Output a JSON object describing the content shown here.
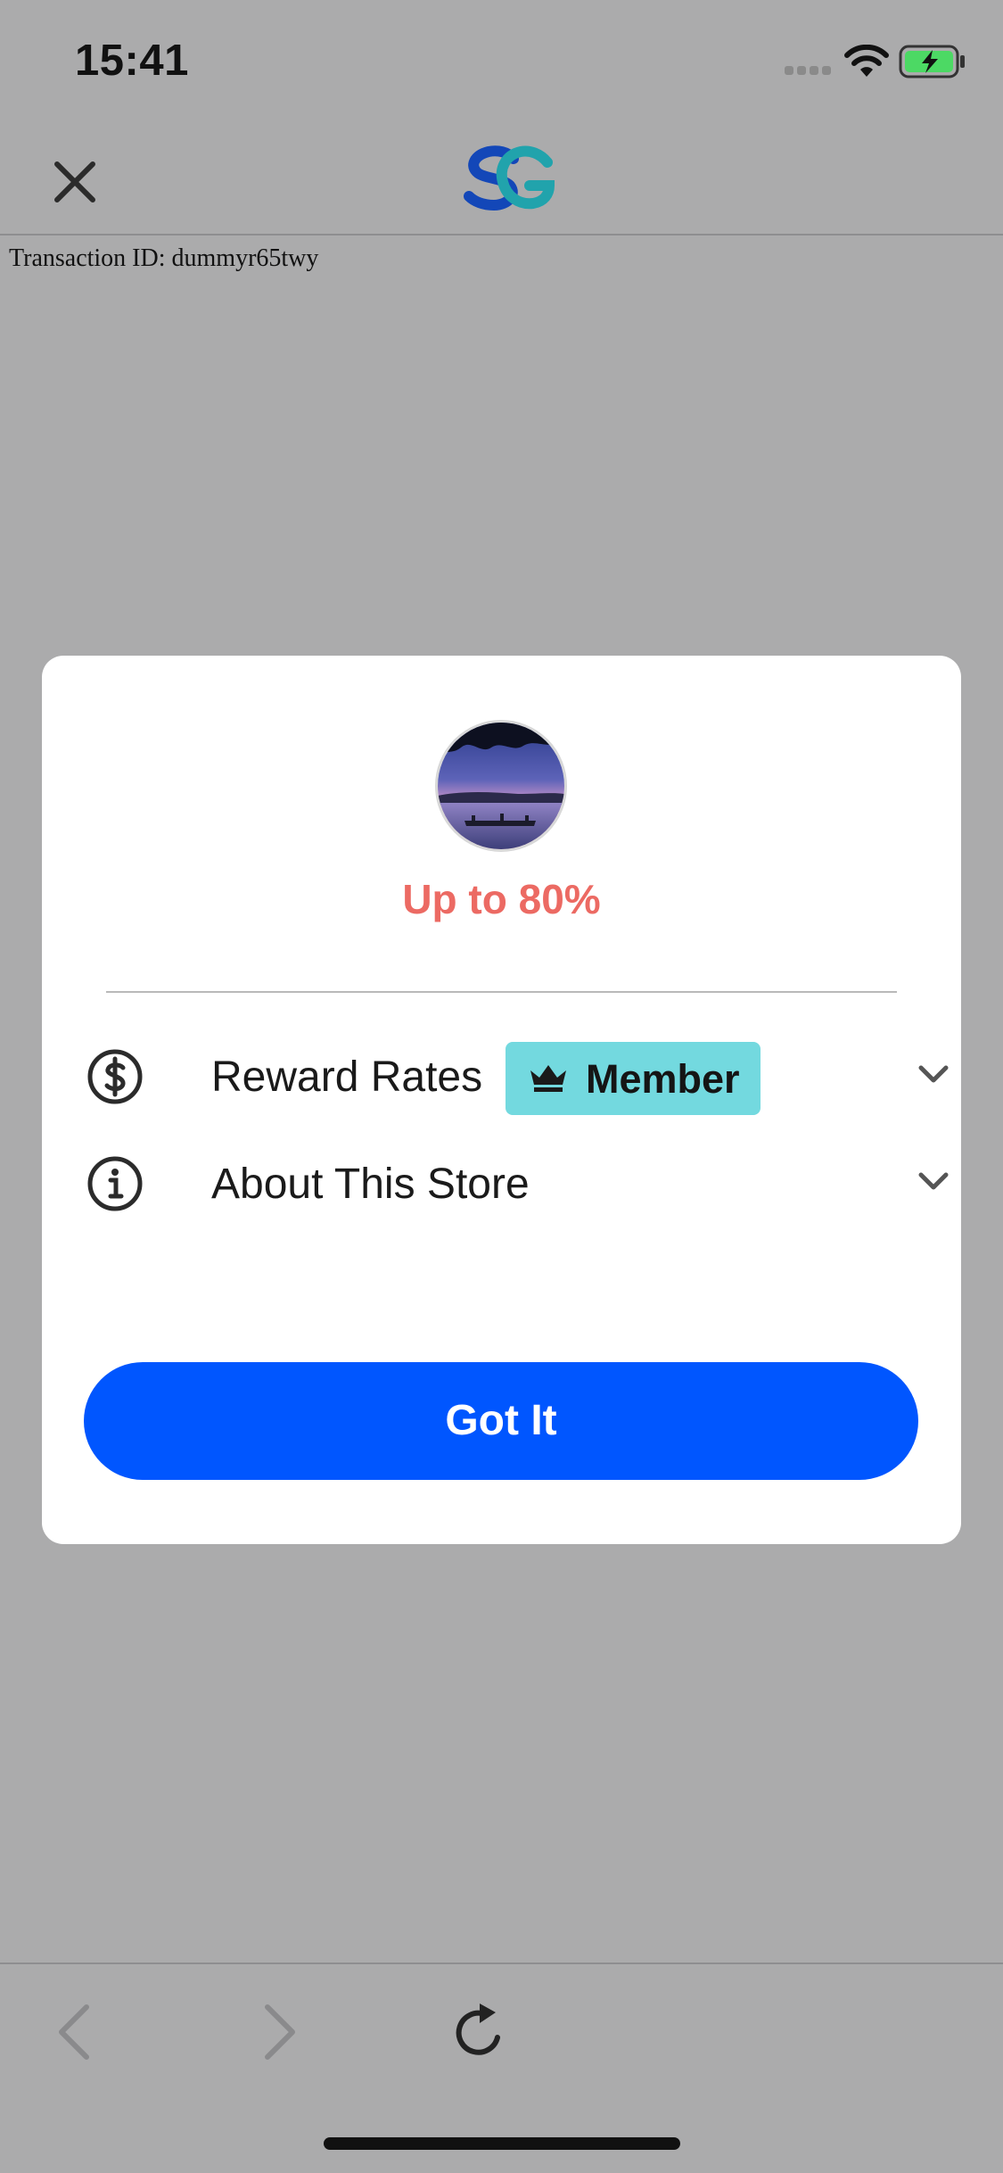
{
  "status_bar": {
    "time": "15:41"
  },
  "nav": {
    "close_icon": "close-icon",
    "logo_colors": {
      "primary": "#1347b8",
      "secondary": "#21a3ac"
    }
  },
  "page": {
    "transaction_id": "Transaction ID: dummyr65twy"
  },
  "modal": {
    "store_image": "sunset-lake-photo",
    "reward_headline": "Up to 80%",
    "rows": [
      {
        "icon": "dollar-circle-icon",
        "label": "Reward Rates",
        "badge": "Member",
        "expanded": false
      },
      {
        "icon": "info-circle-icon",
        "label": "About This Store",
        "expanded": false
      }
    ],
    "button_label": "Got It"
  },
  "toolbar": {
    "back_icon": "chevron-left-icon",
    "forward_icon": "chevron-right-icon",
    "reload_icon": "reload-icon"
  },
  "colors": {
    "accent": "#0056ff",
    "headline": "#ec6a63",
    "badge": "#73d9df",
    "backdrop": "#ababac"
  }
}
